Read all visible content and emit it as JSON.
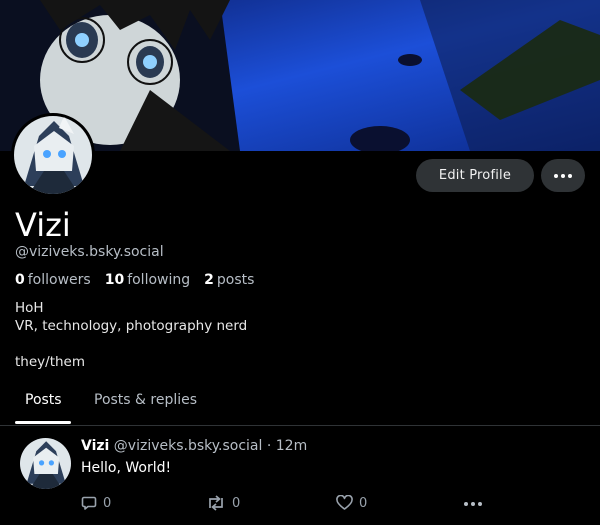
{
  "profile": {
    "display_name": "Vizi",
    "handle": "@viziveks.bsky.social",
    "followers_count": "0",
    "followers_label": "followers",
    "following_count": "10",
    "following_label": "following",
    "posts_count": "2",
    "posts_label": "posts",
    "bio_lines": [
      "HoH",
      "VR, technology, photography nerd",
      "",
      "they/them"
    ]
  },
  "actions": {
    "edit_profile_label": "Edit Profile"
  },
  "tabs": [
    {
      "label": "Posts",
      "active": true
    },
    {
      "label": "Posts & replies",
      "active": false
    }
  ],
  "post": {
    "author_name": "Vizi",
    "author_handle": "@viziveks.bsky.social",
    "separator": "·",
    "timestamp": "12m",
    "text": "Hello, World!",
    "reply_count": "0",
    "repost_count": "0",
    "like_count": "0"
  },
  "icons": {
    "more": "more-horizontal-icon",
    "reply": "speech-bubble-icon",
    "repost": "repost-arrows-icon",
    "like": "heart-icon"
  },
  "colors": {
    "background": "#000000",
    "button_bg": "#2f3336",
    "muted_text": "#b7bec6"
  }
}
